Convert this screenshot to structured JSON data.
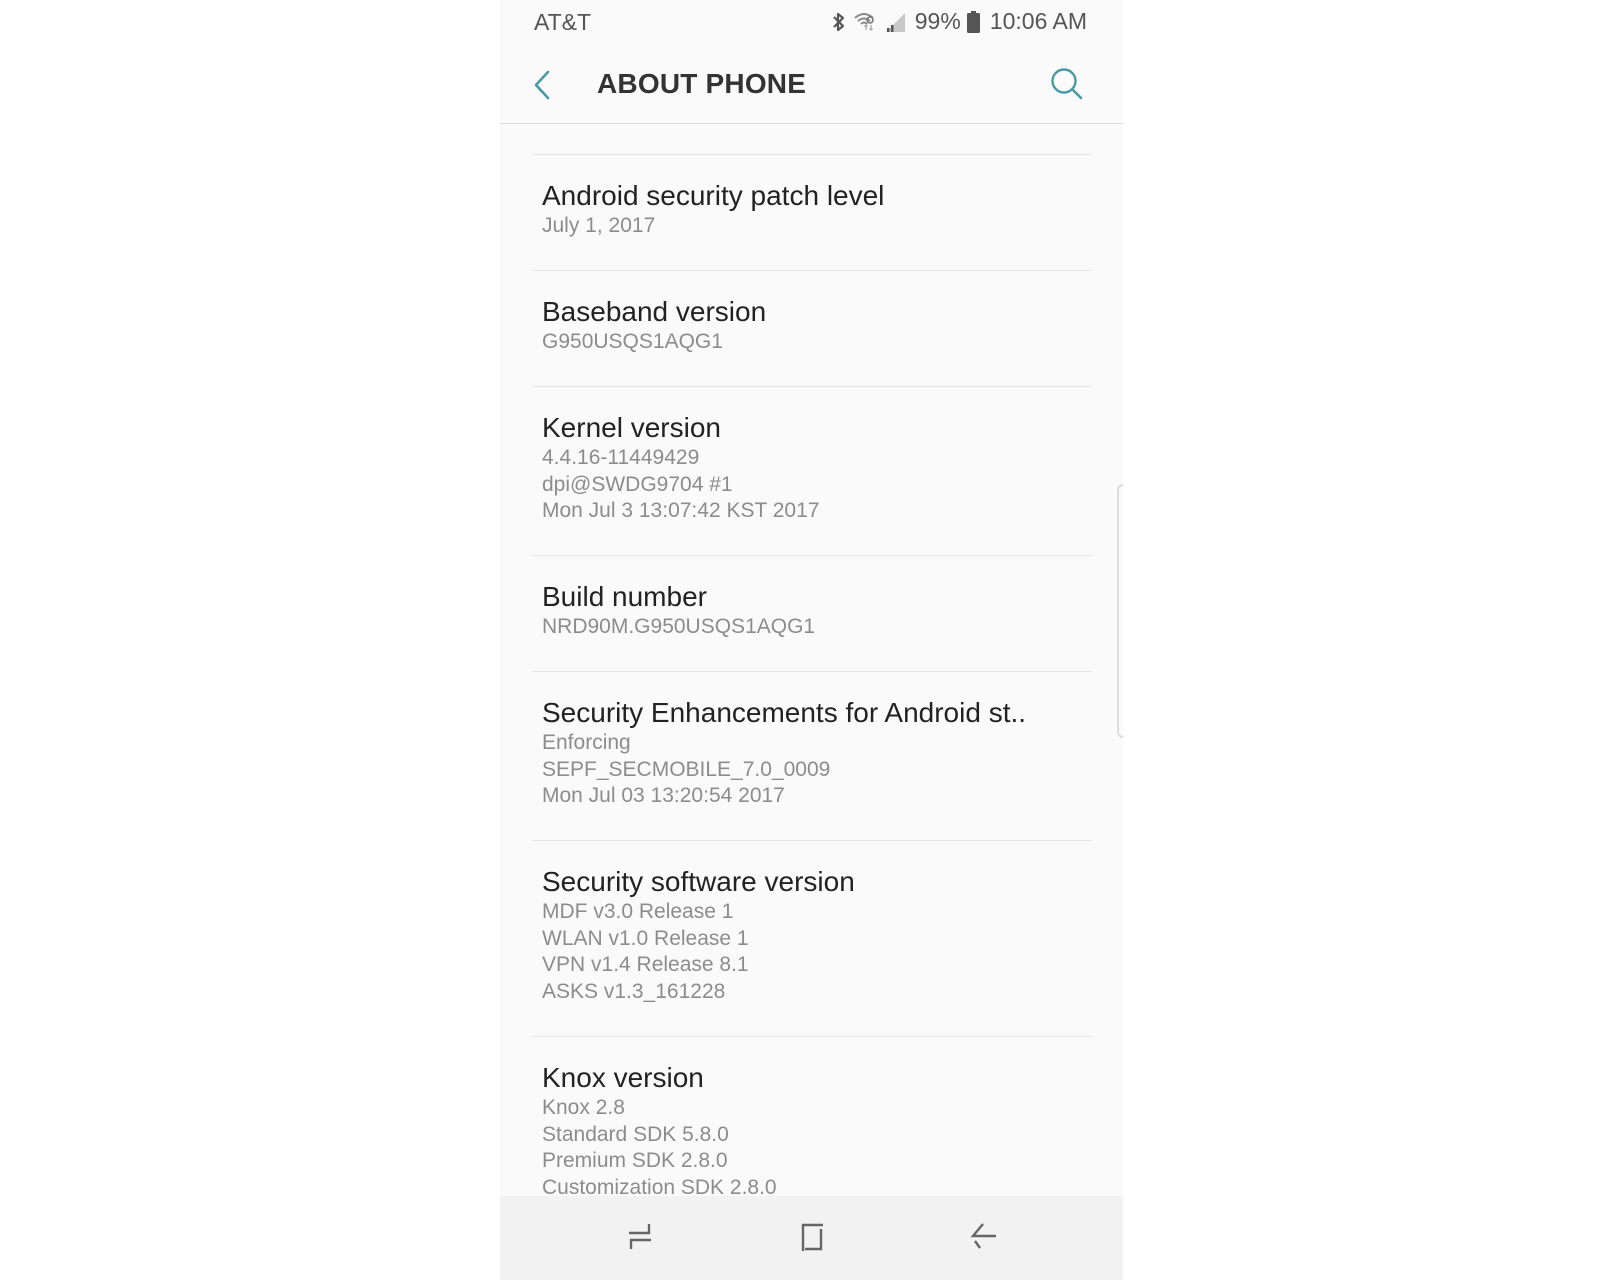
{
  "status_bar": {
    "carrier": "AT&T",
    "icons": [
      "bluetooth-icon",
      "wifi-icon",
      "signal-icon",
      "battery-icon"
    ],
    "battery_percent": "99%",
    "time": "10:06 AM"
  },
  "app_bar": {
    "title": "ABOUT PHONE",
    "back_icon": "chevron-left-icon",
    "search_icon": "search-icon",
    "accent_color": "#4a9aa5"
  },
  "items": [
    {
      "title": "Android security patch level",
      "values": [
        "July 1, 2017"
      ]
    },
    {
      "title": "Baseband version",
      "values": [
        "G950USQS1AQG1"
      ]
    },
    {
      "title": "Kernel version",
      "values": [
        "4.4.16-11449429",
        "dpi@SWDG9704 #1",
        "Mon Jul 3 13:07:42 KST 2017"
      ]
    },
    {
      "title": "Build number",
      "values": [
        "NRD90M.G950USQS1AQG1"
      ]
    },
    {
      "title": "Security Enhancements for Android st..",
      "values": [
        "Enforcing",
        "SEPF_SECMOBILE_7.0_0009",
        "Mon Jul 03 13:20:54 2017"
      ]
    },
    {
      "title": "Security software version",
      "values": [
        "MDF v3.0 Release 1",
        "WLAN v1.0 Release 1",
        "VPN v1.4 Release 8.1",
        "ASKS v1.3_161228"
      ]
    },
    {
      "title": "Knox version",
      "values": [
        "Knox 2.8",
        "Standard SDK 5.8.0",
        "Premium SDK 2.8.0",
        "Customization SDK 2.8.0"
      ]
    }
  ],
  "nav_bar": {
    "buttons": [
      "recent-apps-icon",
      "home-icon",
      "back-arrow-icon"
    ]
  }
}
